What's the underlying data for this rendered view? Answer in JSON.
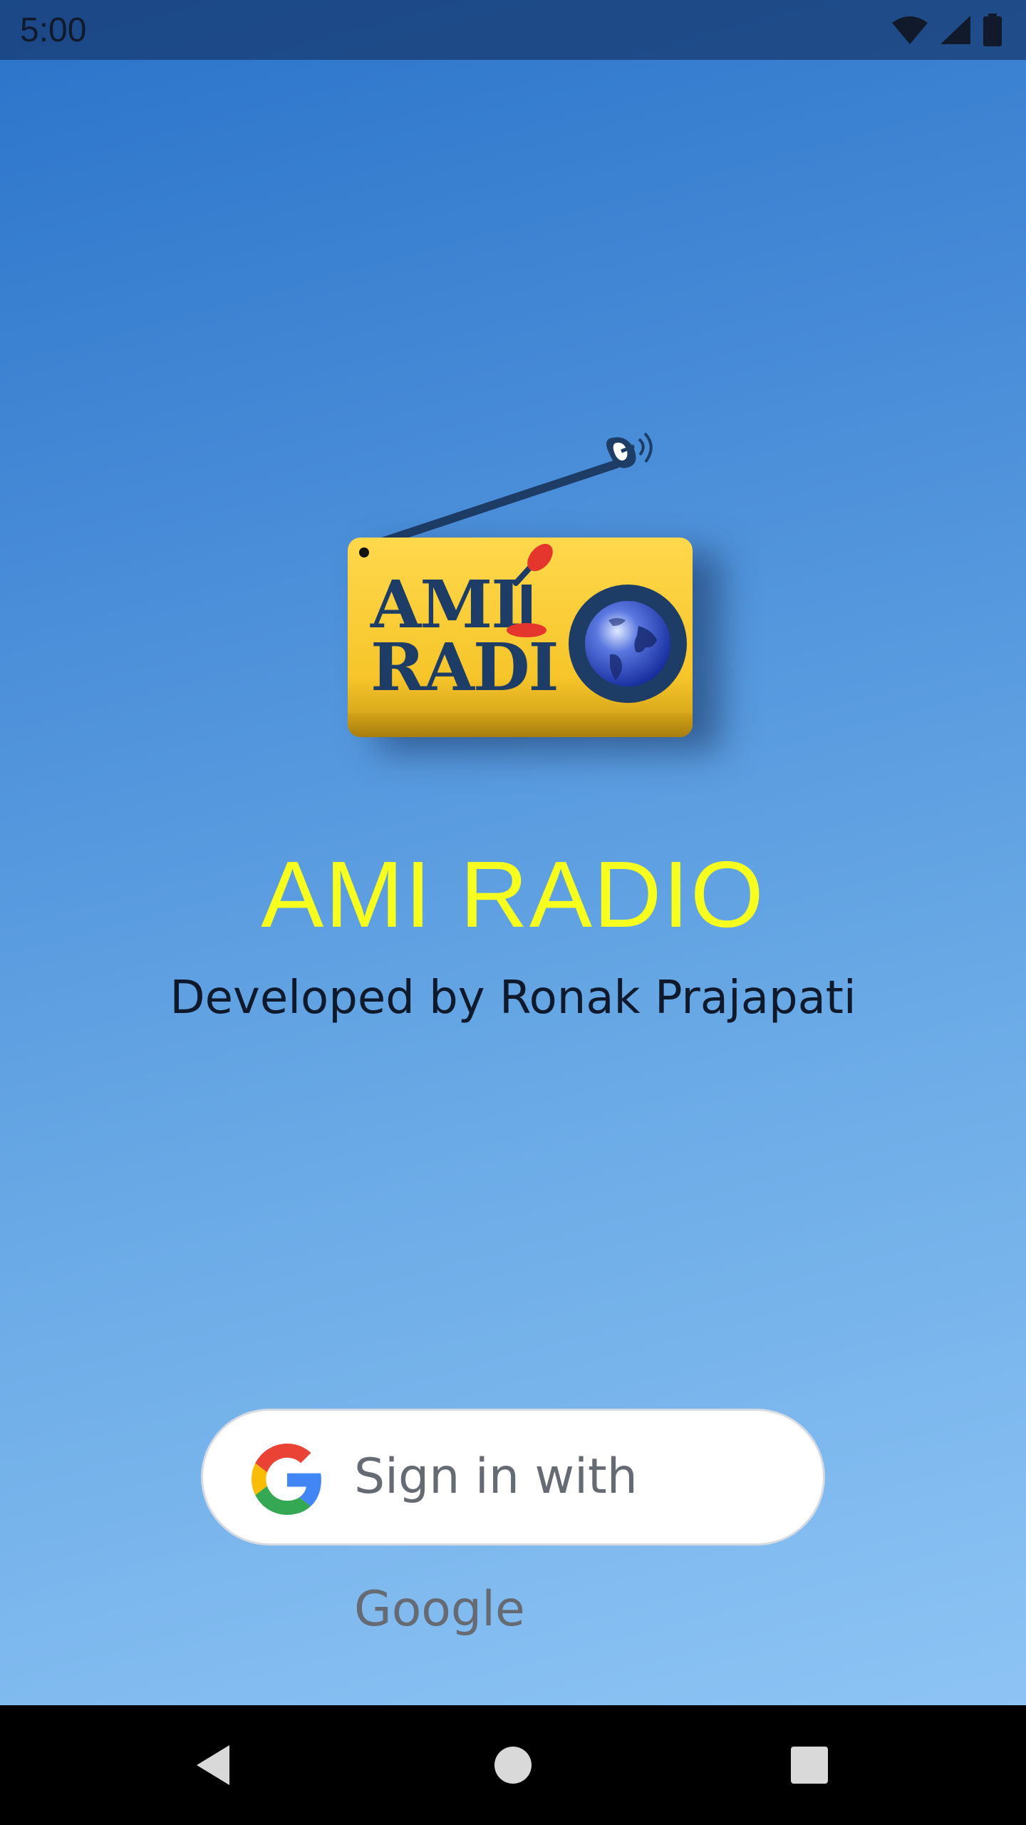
{
  "status_bar": {
    "time": "5:00",
    "icons": [
      "wifi-icon",
      "cellular-signal-icon",
      "battery-icon"
    ]
  },
  "logo": {
    "line1": "AMI",
    "line2": "RADI"
  },
  "app": {
    "title": "AMI RADIO",
    "subtitle": "Developed by Ronak Prajapati"
  },
  "google_signin": {
    "label": "Sign in with Google",
    "icon": "google-g-icon"
  },
  "nav_bar": {
    "buttons": [
      "back-icon",
      "home-icon",
      "recents-icon"
    ]
  },
  "colors": {
    "title": "#f7ff1f",
    "logo_yellow": "#ffd84c",
    "logo_navy": "#1d3d66",
    "background_top": "#2a73c9",
    "background_bottom": "#93c8f7"
  }
}
